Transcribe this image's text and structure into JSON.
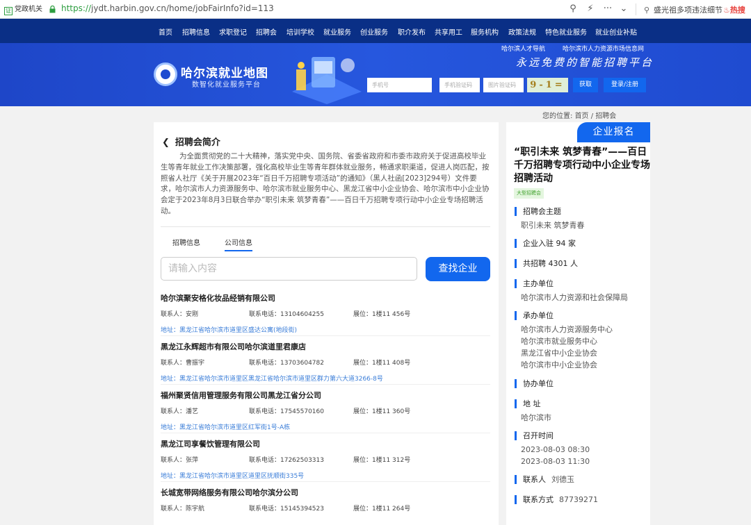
{
  "browser": {
    "gov_badge": "党政机关",
    "url_scheme": "https://",
    "url_rest": "jydt.harbin.gov.cn/home/jobFairInfo?id=113",
    "search_text": "盛光祖多项违法细节",
    "hot_label": "热搜"
  },
  "nav": {
    "items": [
      "首页",
      "招聘信息",
      "求职登记",
      "招聘会",
      "培训学校",
      "就业服务",
      "创业服务",
      "职介发布",
      "共享用工",
      "服务机构",
      "政策法规",
      "特色就业服务",
      "就业创业补贴"
    ]
  },
  "banner": {
    "site_title": "哈尔滨就业地图",
    "site_subtitle": "数智化就业服务平台",
    "top_link_1": "哈尔滨人才导航",
    "top_link_2": "哈尔滨市人力资源市场信息网",
    "slogan": "永远免费的智能招聘平台",
    "phone_placeholder": "手机号",
    "sms_placeholder": "手机验证码",
    "img_code_placeholder": "图片验证码",
    "captcha_text": "9-1=",
    "get_button": "获取",
    "login_button": "登录/注册"
  },
  "breadcrumb": {
    "prefix": "您的位置:",
    "home": "首页",
    "current": "招聘会"
  },
  "main": {
    "title": "招聘会简介",
    "intro": "为全面贯彻党的二十大精神，落实党中央、国务院、省委省政府和市委市政府关于促进高校毕业生等青年就业工作决策部署，强化高校毕业生等青年群体就业服务，畅通求职渠道，促进人岗匹配，按照省人社厅《关于开展2023年“百日千万招聘专项活动”的通知》（黑人社函[2023]294号）文件要求，哈尔滨市人力资源服务中、哈尔滨市就业服务中心、黑龙江省中小企业协会、哈尔滨市中小企业协会定于2023年8月3日联合举办“职引未来 筑梦青春”——百日千万招聘专项行动中小企业专场招聘活动。",
    "tab_jobs": "招聘信息",
    "tab_companies": "公司信息",
    "search_placeholder": "请输入内容",
    "search_button": "查找企业",
    "companies": [
      {
        "name": "哈尔滨聚安格化妆品经销有限公司",
        "contact": "联系人：安刚",
        "phone": "联系电话：13104604255",
        "booth": "展位：1楼11 456号",
        "address": "地址：黑龙江省哈尔滨市道里区盛达公寓(地段街)"
      },
      {
        "name": "黑龙江永辉超市有限公司哈尔滨道里君康店",
        "contact": "联系人：曹振宇",
        "phone": "联系电话：13703604782",
        "booth": "展位：1楼11 408号",
        "address": "地址：黑龙江省哈尔滨市道里区黑龙江省哈尔滨市道里区群力第六大道3266-8号"
      },
      {
        "name": "福州聚贤信用管理服务有限公司黑龙江省分公司",
        "contact": "联系人：潘艺",
        "phone": "联系电话：17545570160",
        "booth": "展位：1楼11 360号",
        "address": "地址：黑龙江省哈尔滨市道里区红军街1号-A栋"
      },
      {
        "name": "黑龙江司享餐饮管理有限公司",
        "contact": "联系人：张萍",
        "phone": "联系电话：17262503313",
        "booth": "展位：1楼11 312号",
        "address": "地址：黑龙江省哈尔滨市道里区道里区抚顺街335号"
      },
      {
        "name": "长城宽带网络服务有限公司哈尔滨分公司",
        "contact": "联系人：陈宇航",
        "phone": "联系电话：15145394523",
        "booth": "展位：1楼11 264号",
        "address": ""
      }
    ]
  },
  "side": {
    "signup_tab": "企业报名",
    "event_title": "“职引未来 筑梦青春”——百日千万招聘专项行动中小企业专场招聘活动",
    "tag": "大型招聘会",
    "theme_label": "招聘会主题",
    "theme_value": "职引未来 筑梦青春",
    "companies_label": "企业入驻 94 家",
    "jobs_label": "共招聘 4301 人",
    "host_label": "主办单位",
    "host_value": "哈尔滨市人力资源和社会保障局",
    "organizer_label": "承办单位",
    "organizers": [
      "哈尔滨市人力资源服务中心",
      "哈尔滨市就业服务中心",
      "黑龙江省中小企业协会",
      "哈尔滨市中小企业协会"
    ],
    "co_label": "协办单位",
    "address_label": "地 址",
    "address_value": "哈尔滨市",
    "time_label": "召开时间",
    "time_start": "2023-08-03 08:30",
    "time_end": "2023-08-03 11:30",
    "contact_label": "联系人",
    "contact_value": "刘德玉",
    "method_label": "联系方式",
    "method_value": "87739271"
  }
}
